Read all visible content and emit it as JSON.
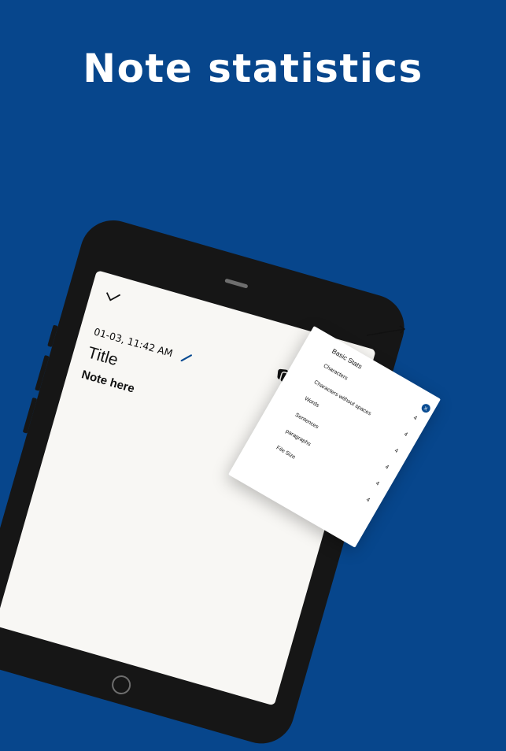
{
  "headline": "Note statistics",
  "note": {
    "timestamp": "01-03, 11:42 AM",
    "title": "Title",
    "body": "Note here"
  },
  "toolbar": {
    "icons": [
      "check-icon",
      "pencil-icon",
      "copy-icon",
      "trash-icon",
      "share-icon",
      "more-vert-icon"
    ]
  },
  "stats": {
    "heading": "Basic Stats",
    "close_label": "x",
    "rows": [
      {
        "label": "Characters",
        "value": "4"
      },
      {
        "label": "Characters without spaces",
        "value": "4"
      },
      {
        "label": "Words",
        "value": "4"
      },
      {
        "label": "Sentences",
        "value": "4"
      },
      {
        "label": "paragraphs",
        "value": "4"
      },
      {
        "label": "File Size",
        "value": "4"
      }
    ]
  },
  "colors": {
    "background": "#07468C",
    "tablet": "#161616",
    "screen": "#F8F7F4",
    "accent": "#0A4C92"
  }
}
